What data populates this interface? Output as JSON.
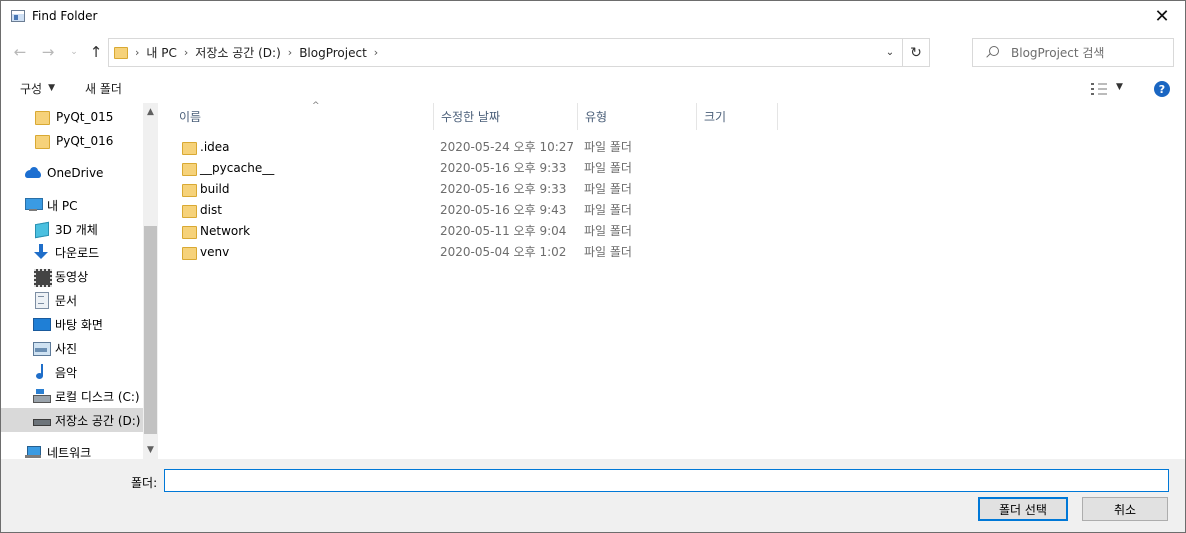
{
  "window": {
    "title": "Find Folder"
  },
  "address": {
    "segments": [
      "내 PC",
      "저장소 공간 (D:)",
      "BlogProject"
    ]
  },
  "search": {
    "placeholder": "BlogProject 검색"
  },
  "toolbar": {
    "organize_label": "구성",
    "new_folder_label": "새 폴더"
  },
  "sidebar": {
    "items": [
      {
        "label": "PyQt_015",
        "icon": "folder-icon"
      },
      {
        "label": "PyQt_016",
        "icon": "folder-icon"
      },
      {
        "label": "OneDrive",
        "icon": "cloud-icon"
      },
      {
        "label": "내 PC",
        "icon": "computer-icon"
      },
      {
        "label": "3D 개체",
        "icon": "cube-icon"
      },
      {
        "label": "다운로드",
        "icon": "download-icon"
      },
      {
        "label": "동영상",
        "icon": "video-icon"
      },
      {
        "label": "문서",
        "icon": "document-icon"
      },
      {
        "label": "바탕 화면",
        "icon": "desktop-icon"
      },
      {
        "label": "사진",
        "icon": "picture-icon"
      },
      {
        "label": "음악",
        "icon": "music-icon"
      },
      {
        "label": "로컬 디스크 (C:)",
        "icon": "drive-icon"
      },
      {
        "label": "저장소 공간 (D:)",
        "icon": "drive-icon"
      },
      {
        "label": "네트워크",
        "icon": "network-icon"
      }
    ],
    "selected": "저장소 공간 (D:)"
  },
  "columns": {
    "name": "이름",
    "modified": "수정한 날짜",
    "type": "유형",
    "size": "크기"
  },
  "files": [
    {
      "name": ".idea",
      "modified": "2020-05-24 오후 10:27",
      "type": "파일 폴더"
    },
    {
      "name": "__pycache__",
      "modified": "2020-05-16 오후 9:33",
      "type": "파일 폴더"
    },
    {
      "name": "build",
      "modified": "2020-05-16 오후 9:33",
      "type": "파일 폴더"
    },
    {
      "name": "dist",
      "modified": "2020-05-16 오후 9:43",
      "type": "파일 폴더"
    },
    {
      "name": "Network",
      "modified": "2020-05-11 오후 9:04",
      "type": "파일 폴더"
    },
    {
      "name": "venv",
      "modified": "2020-05-04 오후 1:02",
      "type": "파일 폴더"
    }
  ],
  "footer": {
    "folder_label": "폴더:",
    "folder_value": "",
    "select_button": "폴더 선택",
    "cancel_button": "취소"
  },
  "colors": {
    "accent": "#0078d7",
    "selection": "#d9d9d9",
    "folder": "#f6d27a"
  }
}
